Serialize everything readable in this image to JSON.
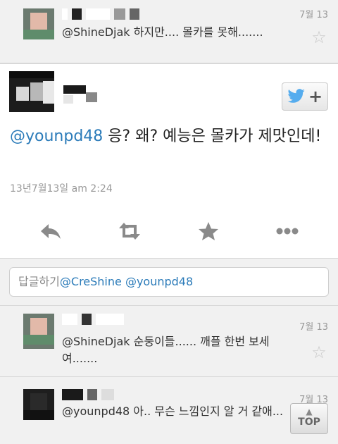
{
  "replies_top": {
    "date": "7월 13",
    "text": "@ShineDjak 하지만.... 몰카를 못해......."
  },
  "tweet": {
    "mention": "@younpd48",
    "body": " 응? 왜? 예능은 몰카가 제맛인데!",
    "timestamp": "13년7월13일 am 2:24",
    "follow_icon": "twitter-bird-icon"
  },
  "actions": {
    "reply_icon": "reply-icon",
    "retweet_icon": "retweet-icon",
    "favorite_icon": "star-icon",
    "more_icon": "more-icon"
  },
  "reply_box": {
    "prefix": "답글하기",
    "value": "@CreShine @younpd48"
  },
  "replies_bottom": [
    {
      "date": "7월 13",
      "text": "@ShineDjak 순둥이들...... 깨플 한번 보세\n여......."
    },
    {
      "date": "7월 13",
      "text": "@younpd48 아.. 무슨 느낌인지 알 거 같애..."
    }
  ],
  "top_button": {
    "label": "TOP"
  },
  "colors": {
    "mention": "#2b7bb9",
    "twitter_blue": "#55acee",
    "icon_gray": "#888888"
  }
}
